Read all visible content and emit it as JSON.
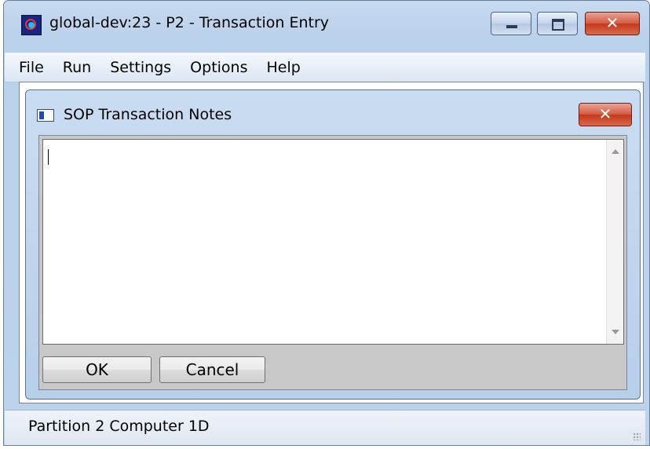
{
  "window": {
    "title": "global-dev:23 - P2 - Transaction Entry",
    "icon": "app-icon",
    "buttons": {
      "minimize": "minimize-icon",
      "maximize": "maximize-icon",
      "close": "✕"
    }
  },
  "menu": {
    "items": [
      "File",
      "Run",
      "Settings",
      "Options",
      "Help"
    ]
  },
  "dialog": {
    "title": "SOP Transaction Notes",
    "close_glyph": "✕",
    "notes_value": "",
    "ok_label": "OK",
    "cancel_label": "Cancel"
  },
  "status": {
    "text": "Partition 2 Computer 1D"
  },
  "colors": {
    "frame": "#b9d1ea",
    "close_red": "#c5371c",
    "dialog_panel": "#c8c8c8"
  }
}
